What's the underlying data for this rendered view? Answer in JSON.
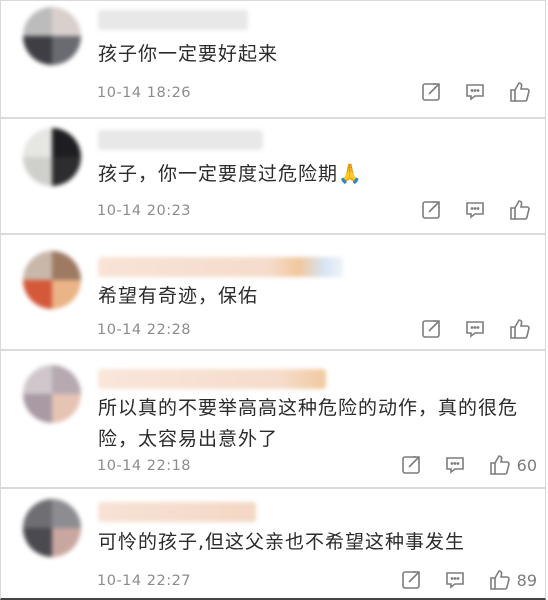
{
  "colors": {
    "text": "#2b2b2b",
    "time": "#8c8c8c",
    "icon": "#7d7d7d",
    "border": "#d9d9d9"
  },
  "icons": {
    "share": "share-icon",
    "comment": "comment-icon",
    "like": "thumbs-up-icon"
  },
  "comments": [
    {
      "text": "孩子你一定要好起来",
      "time": "10-14 18:26",
      "likes": ""
    },
    {
      "text": "孩子，你一定要度过危险期🙏",
      "time": "10-14 20:23",
      "likes": ""
    },
    {
      "text": "希望有奇迹，保佑",
      "time": "10-14 22:28",
      "likes": ""
    },
    {
      "text": "所以真的不要举高高这种危险的动作，真的很危险，太容易出意外了",
      "time": "10-14 22:18",
      "likes": "60"
    },
    {
      "text": "可怜的孩子,但这父亲也不希望这种事发生",
      "time": "10-14 22:27",
      "likes": "89"
    }
  ]
}
